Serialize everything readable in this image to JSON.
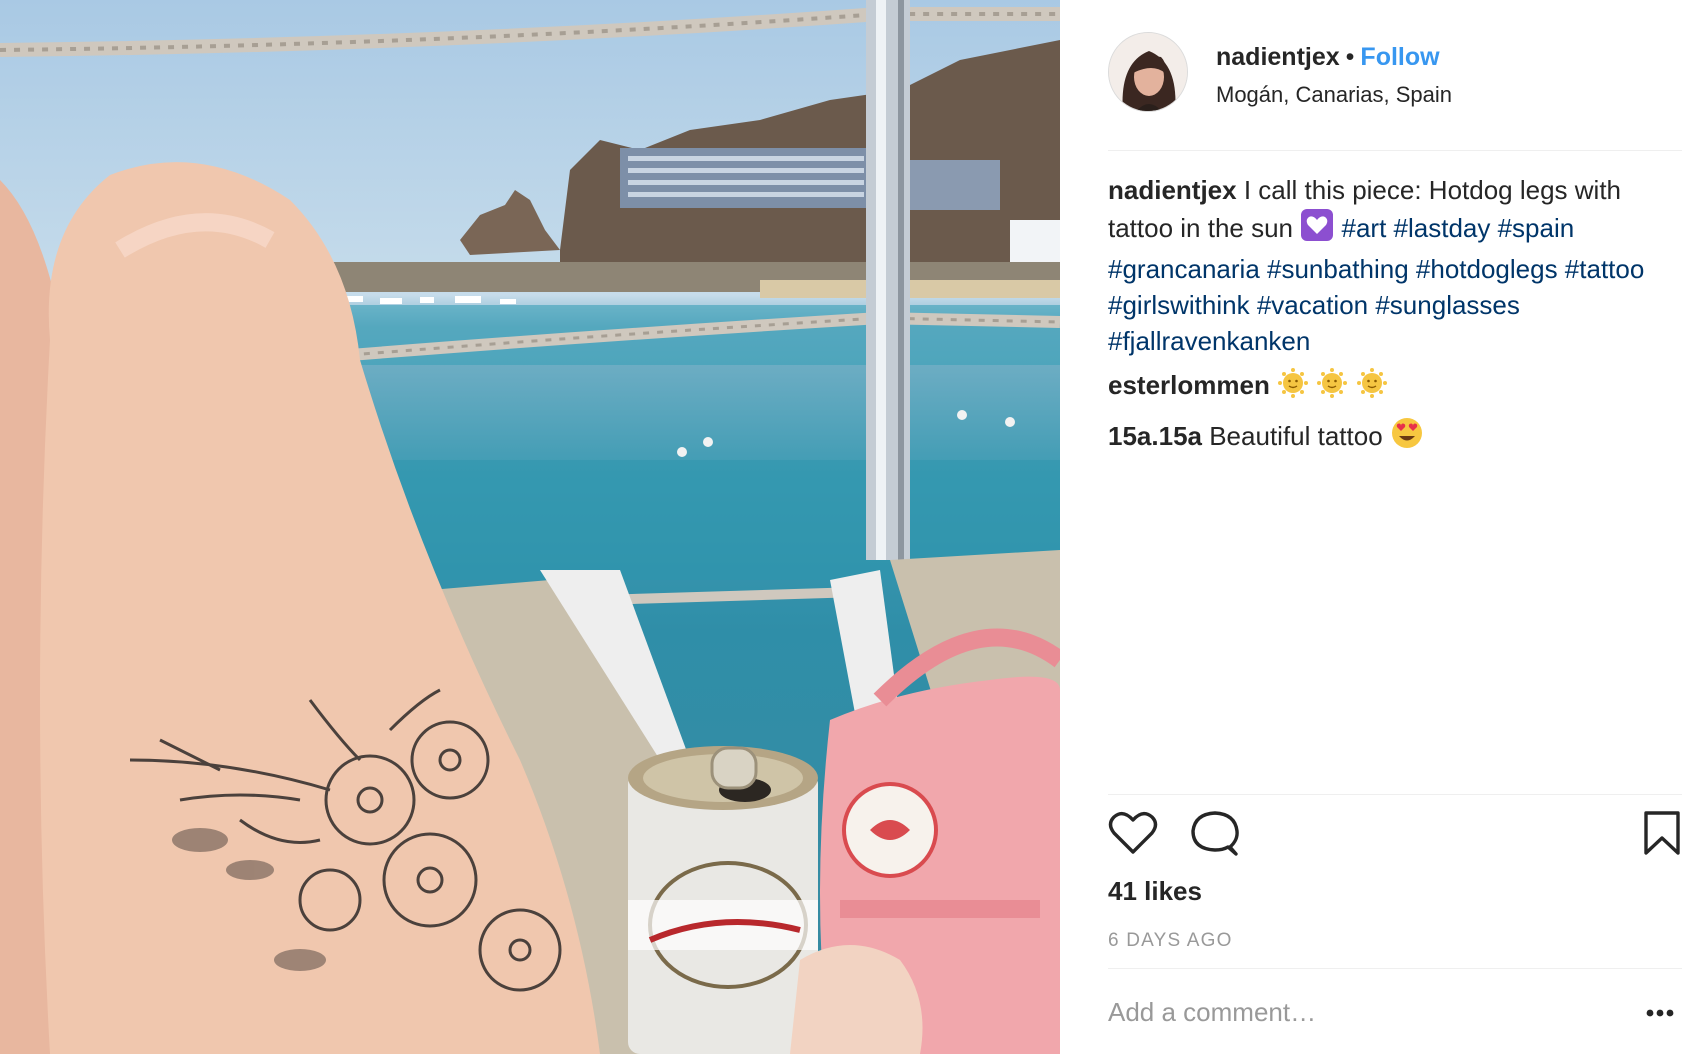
{
  "post": {
    "username": "nadientjex",
    "separator": "•",
    "follow_label": "Follow",
    "location": "Mogán, Canarias, Spain"
  },
  "caption": {
    "username": "nadientjex",
    "text": "I call this piece: Hotdog legs with tattoo in the sun",
    "emoji": "purple-heart-emoji",
    "hashtags": "#art #lastday #spain #grancanaria #sunbathing #hotdoglegs #tattoo #girlswithink #vacation #sunglasses #fjallravenkanken"
  },
  "comments": [
    {
      "username": "esterlommen",
      "text": "",
      "emojis": [
        "sun-face-emoji",
        "sun-face-emoji",
        "sun-face-emoji"
      ]
    },
    {
      "username": "15a.15a",
      "text": "Beautiful tattoo",
      "emojis": [
        "heart-eyes-emoji"
      ]
    }
  ],
  "likes": "41 likes",
  "timestamp": "6 DAYS AGO",
  "add_comment": {
    "placeholder": "Add a comment…"
  },
  "icons": {
    "like": "heart-icon",
    "comment": "speech-bubble-icon",
    "save": "bookmark-icon",
    "more": "more-options-icon"
  },
  "colors": {
    "link": "#3897f0",
    "hashtag": "#003569",
    "text": "#262626",
    "muted": "#999999",
    "divider": "#efefef"
  }
}
